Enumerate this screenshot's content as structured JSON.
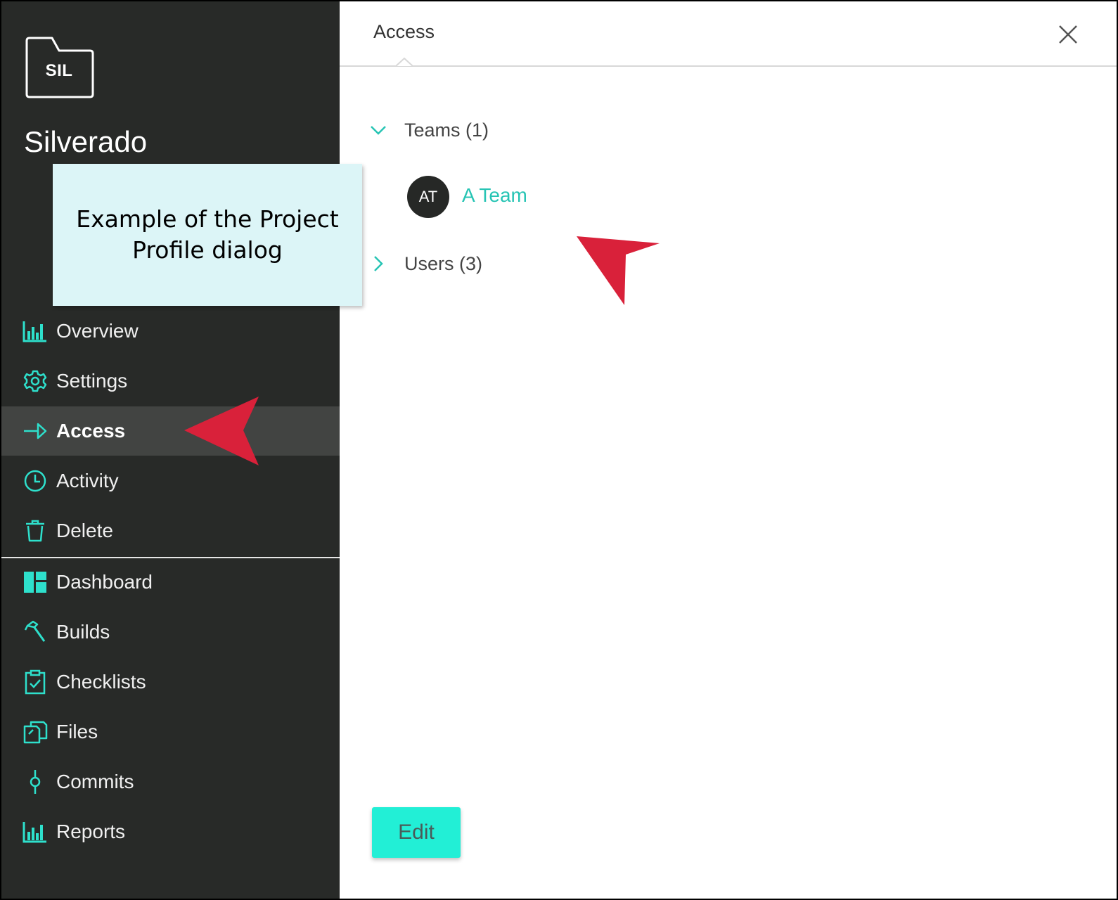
{
  "colors": {
    "sidebar_bg": "#282a28",
    "active_bg": "#424442",
    "accent": "#22efd6",
    "icon": "#2ee0cc",
    "link": "#27c4b4",
    "callout_bg": "#dcf5f7",
    "annotation_arrow": "#d9213a"
  },
  "sidebar": {
    "project_abbrev": "SIL",
    "project_name": "Silverado",
    "items": [
      {
        "label": "Overview",
        "icon": "bar-chart-icon"
      },
      {
        "label": "Settings",
        "icon": "gear-icon"
      },
      {
        "label": "Access",
        "icon": "arrow-right-icon",
        "active": true
      },
      {
        "label": "Activity",
        "icon": "clock-icon"
      },
      {
        "label": "Delete",
        "icon": "trash-icon"
      }
    ],
    "secondary_items": [
      {
        "label": "Dashboard",
        "icon": "dashboard-icon"
      },
      {
        "label": "Builds",
        "icon": "hammer-icon"
      },
      {
        "label": "Checklists",
        "icon": "clipboard-check-icon"
      },
      {
        "label": "Files",
        "icon": "files-icon"
      },
      {
        "label": "Commits",
        "icon": "commit-icon"
      },
      {
        "label": "Reports",
        "icon": "bar-chart-icon"
      }
    ]
  },
  "main": {
    "title": "Access",
    "sections": [
      {
        "label": "Teams (1)",
        "expanded": true
      },
      {
        "label": "Users (3)",
        "expanded": false
      }
    ],
    "teams": [
      {
        "initials": "AT",
        "name": "A Team"
      }
    ],
    "edit_label": "Edit"
  },
  "callout": {
    "text": "Example of the Project Profile dialog"
  }
}
